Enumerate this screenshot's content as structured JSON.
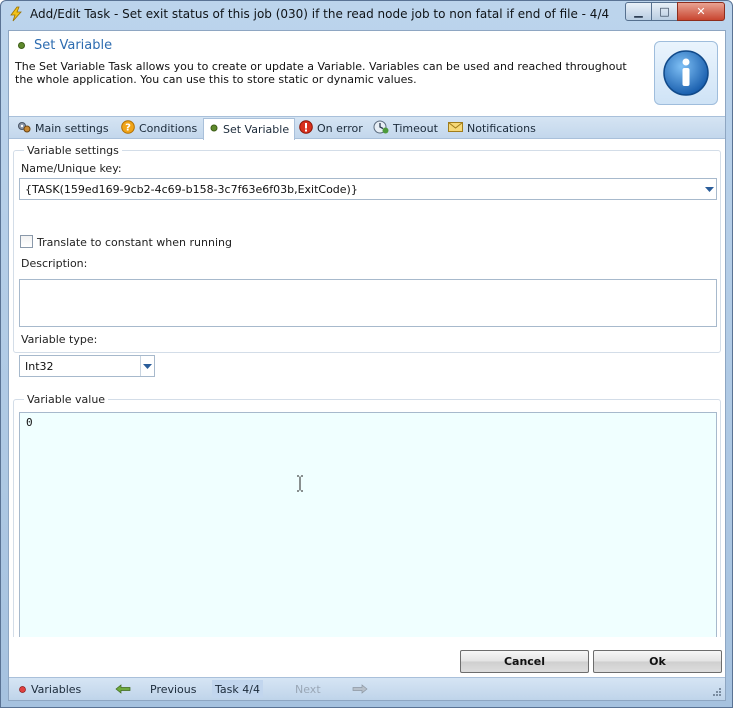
{
  "window": {
    "title": "Add/Edit Task - Set exit status of this job (030) if the  read node job to non fatal if end of file - 4/4",
    "title_icon": "lightning-icon",
    "minimize_glyph": "▁",
    "maximize_glyph": "□",
    "close_glyph": "✕"
  },
  "header": {
    "title": "Set Variable",
    "description": "The Set Variable Task allows you to create or update a Variable. Variables can be used and reached throughout the whole application. You can use this to store static or dynamic values.",
    "icon": "info-icon"
  },
  "tabs": [
    {
      "label": "Main settings",
      "icon": "gears-icon"
    },
    {
      "label": "Conditions",
      "icon": "question-icon"
    },
    {
      "label": "Set Variable",
      "icon": "bullet-icon",
      "active": true
    },
    {
      "label": "On error",
      "icon": "error-icon"
    },
    {
      "label": "Timeout",
      "icon": "clock-icon"
    },
    {
      "label": "Notifications",
      "icon": "envelope-icon"
    }
  ],
  "variable_settings": {
    "legend": "Variable settings",
    "name_label": "Name/Unique key:",
    "name_value": "{TASK(159ed169-9cb2-4c69-b158-3c7f63e6f03b,ExitCode)}",
    "translate_label": "Translate to constant when running",
    "translate_checked": false,
    "description_label": "Description:",
    "description_value": "",
    "type_label": "Variable type:",
    "type_value": "Int32"
  },
  "variable_value": {
    "legend": "Variable value",
    "value": "0"
  },
  "buttons": {
    "cancel": "Cancel",
    "ok": "Ok"
  },
  "statusbar": {
    "variables": "Variables",
    "previous": "Previous",
    "task_counter": "Task 4/4",
    "next": "Next"
  },
  "colors": {
    "accent": "#2d6cb0",
    "value_background": "#f0ffff",
    "chrome": "#bcd4ec"
  }
}
